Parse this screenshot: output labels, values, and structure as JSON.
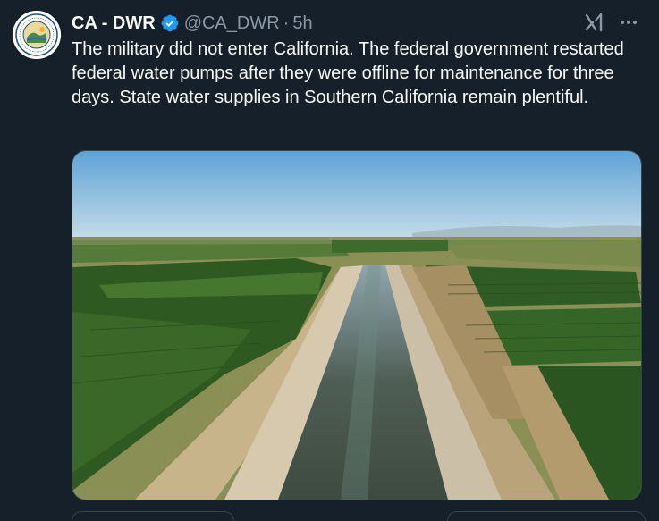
{
  "tweet": {
    "display_name": "CA - DWR",
    "handle": "@CA_DWR",
    "separator": "·",
    "time": "5h",
    "text": "The military did not enter California. The federal government restarted federal water pumps after they were offline for maintenance for three days. State water supplies in Southern California remain plentiful."
  },
  "icons": {
    "avatar": "dwr-seal-avatar",
    "verified": "verified-badge-icon",
    "grok": "grok-icon",
    "more": "more-options-icon"
  },
  "colors": {
    "background": "#15202b",
    "text": "#f7f9f9",
    "secondary_text": "#8b98a5",
    "verified": "#1d9bf0",
    "border": "#38444d"
  }
}
